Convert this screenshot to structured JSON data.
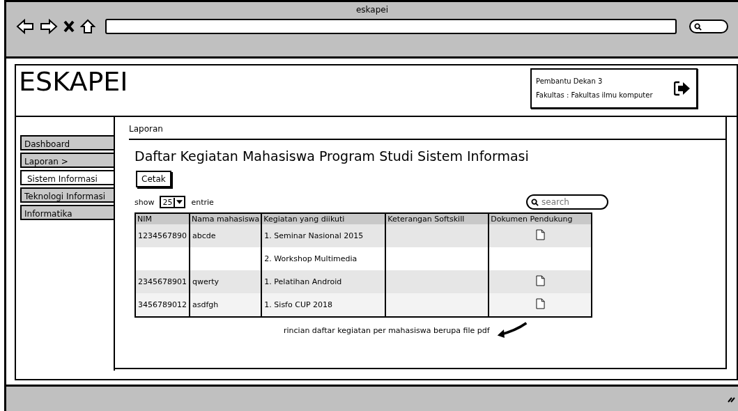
{
  "window": {
    "title": "eskapei"
  },
  "header": {
    "logo": "ESKAPEI",
    "user_role": "Pembantu Dekan 3",
    "faculty": "Fakultas  : Fakultas ilmu komputer"
  },
  "sidebar": {
    "items": [
      {
        "label": "Dashboard",
        "selected": false
      },
      {
        "label": "Laporan >",
        "selected": false
      },
      {
        "label": "Sistem Informasi",
        "selected": true
      },
      {
        "label": "Teknologi Informasi",
        "selected": false
      },
      {
        "label": "Informatika",
        "selected": false
      }
    ]
  },
  "breadcrumb": "Laporan",
  "page_title": "Daftar Kegiatan Mahasiswa Program Studi Sistem Informasi",
  "print_button": "Cetak",
  "entries": {
    "show_label": "show",
    "value": "25",
    "suffix": "entrie"
  },
  "search": {
    "placeholder": "search"
  },
  "table": {
    "columns": [
      "NIM",
      "Nama mahasiswa",
      "Kegiatan yang diikuti",
      "Keterangan Softskill",
      "Dokumen Pendukung"
    ],
    "rows": [
      {
        "nim": "1234567890",
        "name": "abcde",
        "activity": "1. Seminar Nasional 2015",
        "has_document": true
      },
      {
        "activity": "2. Workshop Multimedia",
        "has_document": false
      },
      {
        "nim": "2345678901",
        "name": "qwerty",
        "activity": "1. Pelatihan Android",
        "has_document": true
      },
      {
        "nim": "3456789012",
        "name": "asdfgh",
        "activity": "1. Sisfo CUP 2018",
        "has_document": true
      }
    ]
  },
  "note": "rincian daftar kegiatan per mahasiswa berupa file pdf"
}
